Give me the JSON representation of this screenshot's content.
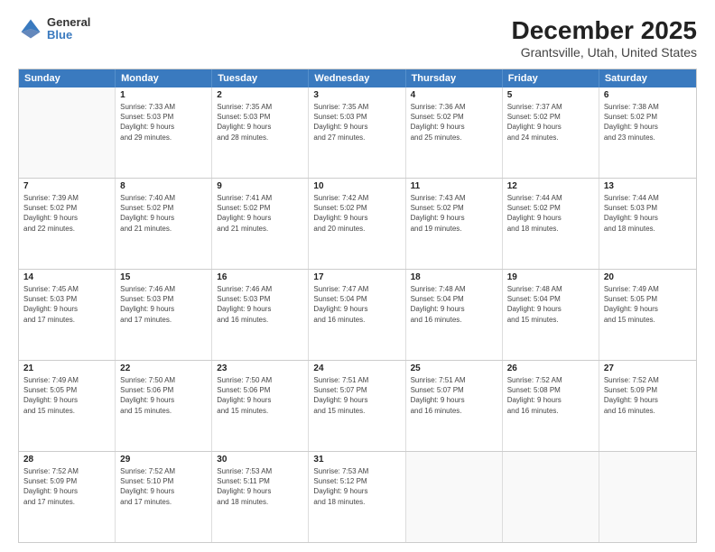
{
  "header": {
    "logo_general": "General",
    "logo_blue": "Blue",
    "month_title": "December 2025",
    "location": "Grantsville, Utah, United States"
  },
  "calendar": {
    "days_of_week": [
      "Sunday",
      "Monday",
      "Tuesday",
      "Wednesday",
      "Thursday",
      "Friday",
      "Saturday"
    ],
    "rows": [
      [
        {
          "num": "",
          "detail": ""
        },
        {
          "num": "1",
          "detail": "Sunrise: 7:33 AM\nSunset: 5:03 PM\nDaylight: 9 hours\nand 29 minutes."
        },
        {
          "num": "2",
          "detail": "Sunrise: 7:35 AM\nSunset: 5:03 PM\nDaylight: 9 hours\nand 28 minutes."
        },
        {
          "num": "3",
          "detail": "Sunrise: 7:35 AM\nSunset: 5:03 PM\nDaylight: 9 hours\nand 27 minutes."
        },
        {
          "num": "4",
          "detail": "Sunrise: 7:36 AM\nSunset: 5:02 PM\nDaylight: 9 hours\nand 25 minutes."
        },
        {
          "num": "5",
          "detail": "Sunrise: 7:37 AM\nSunset: 5:02 PM\nDaylight: 9 hours\nand 24 minutes."
        },
        {
          "num": "6",
          "detail": "Sunrise: 7:38 AM\nSunset: 5:02 PM\nDaylight: 9 hours\nand 23 minutes."
        }
      ],
      [
        {
          "num": "7",
          "detail": "Sunrise: 7:39 AM\nSunset: 5:02 PM\nDaylight: 9 hours\nand 22 minutes."
        },
        {
          "num": "8",
          "detail": "Sunrise: 7:40 AM\nSunset: 5:02 PM\nDaylight: 9 hours\nand 21 minutes."
        },
        {
          "num": "9",
          "detail": "Sunrise: 7:41 AM\nSunset: 5:02 PM\nDaylight: 9 hours\nand 21 minutes."
        },
        {
          "num": "10",
          "detail": "Sunrise: 7:42 AM\nSunset: 5:02 PM\nDaylight: 9 hours\nand 20 minutes."
        },
        {
          "num": "11",
          "detail": "Sunrise: 7:43 AM\nSunset: 5:02 PM\nDaylight: 9 hours\nand 19 minutes."
        },
        {
          "num": "12",
          "detail": "Sunrise: 7:44 AM\nSunset: 5:02 PM\nDaylight: 9 hours\nand 18 minutes."
        },
        {
          "num": "13",
          "detail": "Sunrise: 7:44 AM\nSunset: 5:03 PM\nDaylight: 9 hours\nand 18 minutes."
        }
      ],
      [
        {
          "num": "14",
          "detail": "Sunrise: 7:45 AM\nSunset: 5:03 PM\nDaylight: 9 hours\nand 17 minutes."
        },
        {
          "num": "15",
          "detail": "Sunrise: 7:46 AM\nSunset: 5:03 PM\nDaylight: 9 hours\nand 17 minutes."
        },
        {
          "num": "16",
          "detail": "Sunrise: 7:46 AM\nSunset: 5:03 PM\nDaylight: 9 hours\nand 16 minutes."
        },
        {
          "num": "17",
          "detail": "Sunrise: 7:47 AM\nSunset: 5:04 PM\nDaylight: 9 hours\nand 16 minutes."
        },
        {
          "num": "18",
          "detail": "Sunrise: 7:48 AM\nSunset: 5:04 PM\nDaylight: 9 hours\nand 16 minutes."
        },
        {
          "num": "19",
          "detail": "Sunrise: 7:48 AM\nSunset: 5:04 PM\nDaylight: 9 hours\nand 15 minutes."
        },
        {
          "num": "20",
          "detail": "Sunrise: 7:49 AM\nSunset: 5:05 PM\nDaylight: 9 hours\nand 15 minutes."
        }
      ],
      [
        {
          "num": "21",
          "detail": "Sunrise: 7:49 AM\nSunset: 5:05 PM\nDaylight: 9 hours\nand 15 minutes."
        },
        {
          "num": "22",
          "detail": "Sunrise: 7:50 AM\nSunset: 5:06 PM\nDaylight: 9 hours\nand 15 minutes."
        },
        {
          "num": "23",
          "detail": "Sunrise: 7:50 AM\nSunset: 5:06 PM\nDaylight: 9 hours\nand 15 minutes."
        },
        {
          "num": "24",
          "detail": "Sunrise: 7:51 AM\nSunset: 5:07 PM\nDaylight: 9 hours\nand 15 minutes."
        },
        {
          "num": "25",
          "detail": "Sunrise: 7:51 AM\nSunset: 5:07 PM\nDaylight: 9 hours\nand 16 minutes."
        },
        {
          "num": "26",
          "detail": "Sunrise: 7:52 AM\nSunset: 5:08 PM\nDaylight: 9 hours\nand 16 minutes."
        },
        {
          "num": "27",
          "detail": "Sunrise: 7:52 AM\nSunset: 5:09 PM\nDaylight: 9 hours\nand 16 minutes."
        }
      ],
      [
        {
          "num": "28",
          "detail": "Sunrise: 7:52 AM\nSunset: 5:09 PM\nDaylight: 9 hours\nand 17 minutes."
        },
        {
          "num": "29",
          "detail": "Sunrise: 7:52 AM\nSunset: 5:10 PM\nDaylight: 9 hours\nand 17 minutes."
        },
        {
          "num": "30",
          "detail": "Sunrise: 7:53 AM\nSunset: 5:11 PM\nDaylight: 9 hours\nand 18 minutes."
        },
        {
          "num": "31",
          "detail": "Sunrise: 7:53 AM\nSunset: 5:12 PM\nDaylight: 9 hours\nand 18 minutes."
        },
        {
          "num": "",
          "detail": ""
        },
        {
          "num": "",
          "detail": ""
        },
        {
          "num": "",
          "detail": ""
        }
      ]
    ]
  }
}
